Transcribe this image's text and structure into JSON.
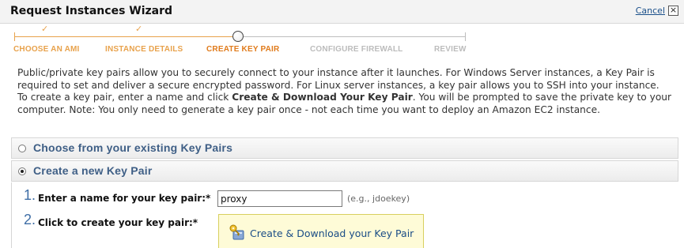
{
  "window": {
    "title": "Request Instances Wizard",
    "cancel_label": "Cancel",
    "close_glyph": "×"
  },
  "steps": [
    {
      "label": "CHOOSE AN AMI",
      "status": "done"
    },
    {
      "label": "INSTANCE DETAILS",
      "status": "done"
    },
    {
      "label": "CREATE KEY PAIR",
      "status": "current"
    },
    {
      "label": "CONFIGURE FIREWALL",
      "status": "todo"
    },
    {
      "label": "REVIEW",
      "status": "todo"
    }
  ],
  "check_glyph": "✓",
  "description": {
    "para1": "Public/private key pairs allow you to securely connect to your instance after it launches. For Windows Server instances, a Key Pair is required to set and deliver a secure encrypted password. For Linux server instances, a key pair allows you to SSH into your instance.",
    "para2_before": "To create a key pair, enter a name and click ",
    "para2_bold": "Create & Download Your Key Pair",
    "para2_after": ". You will be prompted to save the private key to your computer. Note: You only need to generate a key pair once - not each time you want to deploy an Amazon EC2 instance."
  },
  "options": [
    {
      "label": "Choose from your existing Key Pairs",
      "selected": false
    },
    {
      "label": "Create a new Key Pair",
      "selected": true
    }
  ],
  "form": {
    "step1_number": "1.",
    "step1_label": "Enter a name for your key pair:*",
    "name_value": "proxy",
    "name_hint": "(e.g., jdoekey)",
    "step2_number": "2.",
    "step2_label": "Click to create your key pair:*",
    "create_button_label": "Create & Download your Key Pair",
    "create_icon": "key-pair-icon"
  },
  "colors": {
    "step_done": "#e8a24c",
    "step_current": "#e07b1c",
    "step_todo": "#bcbcbc",
    "option_label": "#3f5f86",
    "link": "#1a4d86",
    "create_box_bg": "#fefbd7"
  }
}
